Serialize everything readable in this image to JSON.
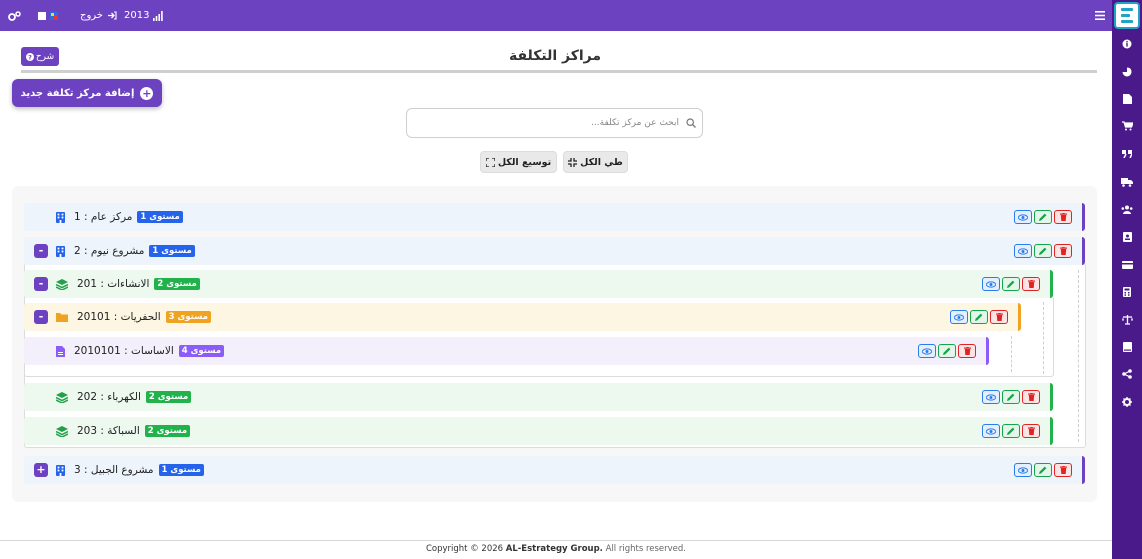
{
  "topbar": {
    "year": "2013",
    "logout_label": "خروج",
    "colors": {
      "bg": "#6d42c1"
    }
  },
  "sidebar": {
    "icons": [
      "info-icon",
      "pie-chart-icon",
      "file-icon",
      "cart-icon",
      "quote-icon",
      "truck-icon",
      "users-icon",
      "contact-card-icon",
      "credit-card-icon",
      "calculator-icon",
      "balance-icon",
      "book-icon",
      "share-icon",
      "settings-icon"
    ],
    "colors": {
      "bg": "#4b1a8a"
    }
  },
  "page": {
    "title": "مراكز التكلفة",
    "help_label": "شرح",
    "add_label": "إضافة مركز تكلفة جديد",
    "search_placeholder": "ابحث عن مركز تكلفة...",
    "collapse_all_label": "طي الكل",
    "expand_all_label": "توسيع الكل"
  },
  "tree": {
    "nodes": [
      {
        "text": "مركز عام : 1",
        "badge": "مستوى 1",
        "level": 1,
        "toggle": "",
        "icon": "building-icon"
      },
      {
        "text": "مشروع نيوم : 2",
        "badge": "مستوى 1",
        "level": 1,
        "toggle": "-",
        "icon": "building-icon"
      },
      {
        "text": "الانشاءات : 201",
        "badge": "مستوى 2",
        "level": 2,
        "toggle": "-",
        "icon": "layers-icon"
      },
      {
        "text": "الحفريات : 20101",
        "badge": "مستوى 3",
        "level": 3,
        "toggle": "-",
        "icon": "folder-icon"
      },
      {
        "text": "الاساسات : 2010101",
        "badge": "مستوى 4",
        "level": 4,
        "toggle": "",
        "icon": "document-icon"
      },
      {
        "text": "الكهرباء : 202",
        "badge": "مستوى 2",
        "level": 2,
        "toggle": "",
        "icon": "layers-icon"
      },
      {
        "text": "السباكة : 203",
        "badge": "مستوى 2",
        "level": 2,
        "toggle": "",
        "icon": "layers-icon"
      },
      {
        "text": "مشروع الجبيل : 3",
        "badge": "مستوى 1",
        "level": 1,
        "toggle": "+",
        "icon": "building-icon"
      }
    ],
    "level_colors": {
      "1": {
        "bg": "#eef4fb",
        "badge": "#2563eb",
        "accent": "#6d42c1",
        "icon": "#2563eb"
      },
      "2": {
        "bg": "#edf8ef",
        "badge": "#22b24c",
        "accent": "#22b24c",
        "icon": "#22a04a"
      },
      "3": {
        "bg": "#fdf6e3",
        "badge": "#f0a322",
        "accent": "#f0a322",
        "icon": "#f0a322"
      },
      "4": {
        "bg": "#f3f0fb",
        "badge": "#8b5cf6",
        "accent": "#8b5cf6",
        "icon": "#8b5cf6"
      }
    }
  },
  "footer": {
    "prefix": "Copyright © 2026 ",
    "company": "AL-Estrategy Group.",
    "suffix": " All rights reserved."
  }
}
